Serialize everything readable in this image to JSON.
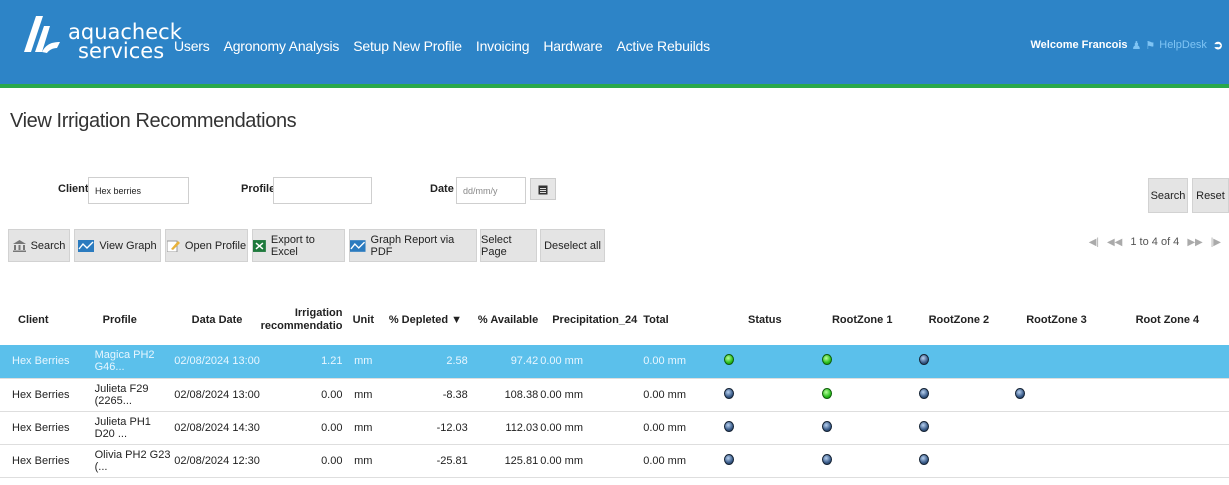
{
  "header": {
    "logo_line1": "aquacheck",
    "logo_line2": "services",
    "nav": [
      "Users",
      "Agronomy Analysis",
      "Setup New Profile",
      "Invoicing",
      "Hardware",
      "Active Rebuilds"
    ],
    "welcome": "Welcome Francois",
    "helpdesk": "HelpDesk",
    "user_icon": "user-icon",
    "bell_icon": "bell-icon",
    "logout_icon": "logout-icon"
  },
  "page_title": "View Irrigation Recommendations",
  "filters": {
    "client_label": "Client",
    "client_value": "Hex berries",
    "profile_label": "Profile",
    "profile_value": "",
    "date_label": "Date",
    "date_placeholder": "dd/mm/y",
    "search_label": "Search",
    "reset_label": "Reset"
  },
  "toolbar": {
    "search": "Search",
    "view_graph": "View Graph",
    "open_profile": "Open Profile",
    "export_excel": "Export to Excel",
    "graph_pdf": "Graph Report via PDF",
    "select_page": "Select Page",
    "deselect_all": "Deselect all"
  },
  "pager": {
    "text": "1 to 4 of 4"
  },
  "table": {
    "columns": [
      "Client",
      "Profile",
      "Data Date",
      "Irrigation recommendatio",
      "Unit",
      "% Depleted ▼",
      "% Available",
      "Precipitation_24",
      "Total",
      "Status",
      "RootZone 1",
      "RootZone 2",
      "RootZone 3",
      "Root Zone 4"
    ],
    "rows": [
      {
        "client": "Hex Berries",
        "profile": "Magica PH2 G46...",
        "date": "02/08/2024 13:00",
        "irrigation": "1.21",
        "unit": "mm",
        "depleted": "2.58",
        "available": "97.42",
        "precip": "0.00 mm",
        "total": "0.00 mm",
        "status": "green",
        "rz1": "green",
        "rz2": "blue",
        "rz3": "",
        "rz4": ""
      },
      {
        "client": "Hex Berries",
        "profile": "Julieta F29 (2265...",
        "date": "02/08/2024 13:00",
        "irrigation": "0.00",
        "unit": "mm",
        "depleted": "-8.38",
        "available": "108.38",
        "precip": "0.00 mm",
        "total": "0.00 mm",
        "status": "blue",
        "rz1": "green",
        "rz2": "blue",
        "rz3": "blue",
        "rz4": ""
      },
      {
        "client": "Hex Berries",
        "profile": "Julieta PH1 D20 ...",
        "date": "02/08/2024 14:30",
        "irrigation": "0.00",
        "unit": "mm",
        "depleted": "-12.03",
        "available": "112.03",
        "precip": "0.00 mm",
        "total": "0.00 mm",
        "status": "blue",
        "rz1": "blue",
        "rz2": "blue",
        "rz3": "",
        "rz4": ""
      },
      {
        "client": "Hex Berries",
        "profile": "Olivia PH2 G23 (...",
        "date": "02/08/2024 12:30",
        "irrigation": "0.00",
        "unit": "mm",
        "depleted": "-25.81",
        "available": "125.81",
        "precip": "0.00 mm",
        "total": "0.00 mm",
        "status": "blue",
        "rz1": "blue",
        "rz2": "blue",
        "rz3": "",
        "rz4": ""
      }
    ]
  },
  "colors": {
    "header_bg": "#2d84c7",
    "header_border": "#2aa84b",
    "selected_row": "#5bc0eb"
  }
}
